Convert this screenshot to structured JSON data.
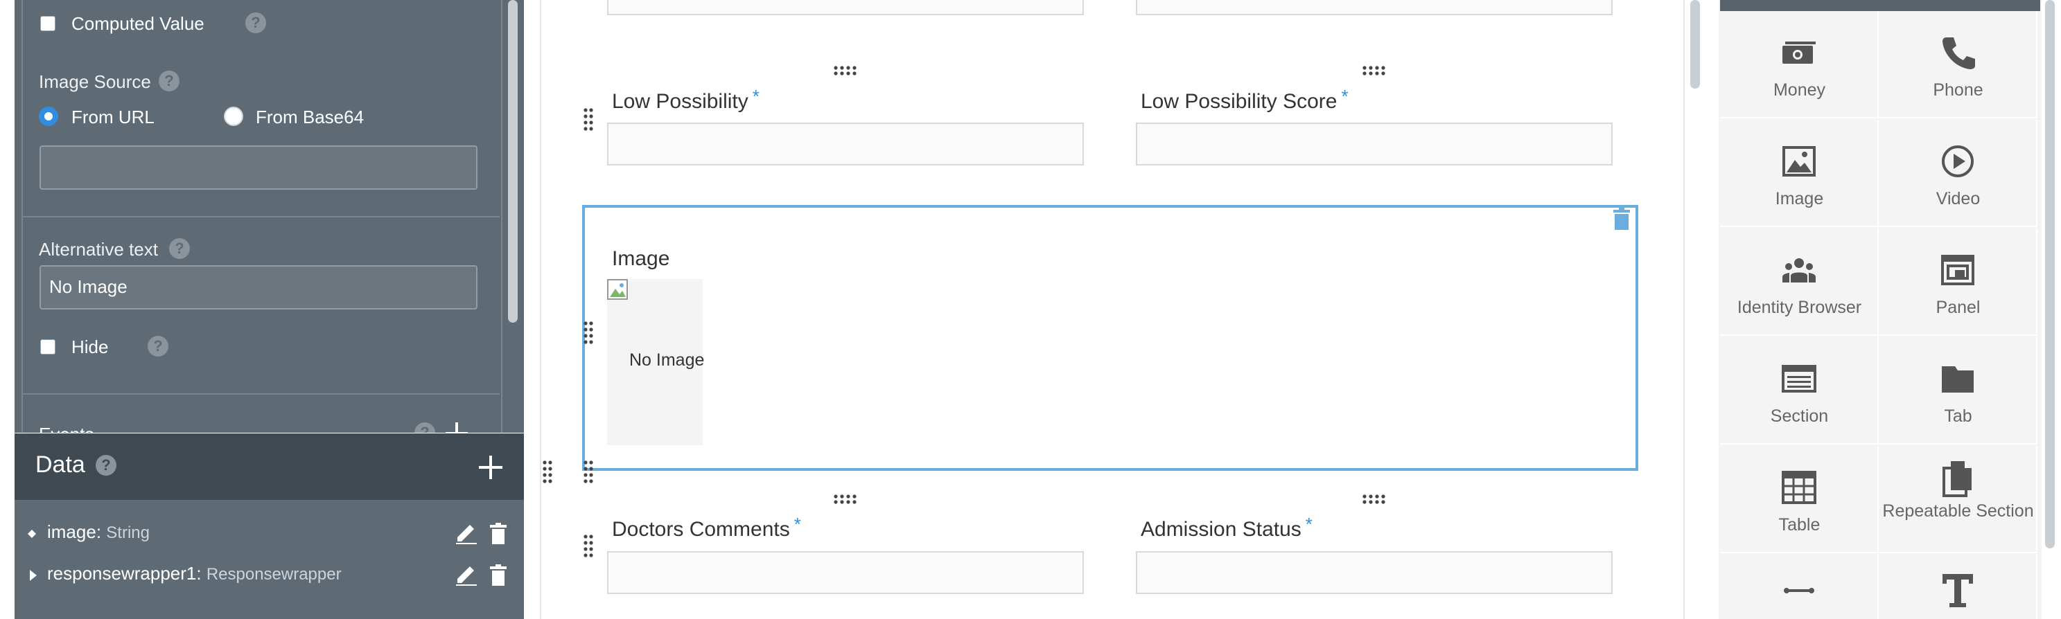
{
  "properties": {
    "computed_value_label": "Computed Value",
    "image_source_label": "Image Source",
    "from_url_label": "From URL",
    "from_base64_label": "From Base64",
    "url_value": "",
    "alt_text_label": "Alternative text",
    "alt_text_value": "No Image",
    "hide_label": "Hide",
    "events_label": "Events",
    "help_glyph": "?"
  },
  "data_panel": {
    "title": "Data",
    "help_glyph": "?",
    "items": [
      {
        "name": "image:",
        "type": "String"
      },
      {
        "name": "responsewrapper1:",
        "type": "Responsewrapper"
      }
    ]
  },
  "form": {
    "row1": [
      {
        "label": "Low Possibility",
        "required": "*"
      },
      {
        "label": "Low Possibility Score",
        "required": "*"
      }
    ],
    "image_block": {
      "label": "Image",
      "placeholder": "No Image"
    },
    "row2": [
      {
        "label": "Doctors Comments",
        "required": "*"
      },
      {
        "label": "Admission Status",
        "required": "*"
      }
    ]
  },
  "palette": {
    "items": [
      {
        "label": "Money",
        "icon": "money-icon"
      },
      {
        "label": "Phone",
        "icon": "phone-icon"
      },
      {
        "label": "Image",
        "icon": "image-icon"
      },
      {
        "label": "Video",
        "icon": "video-icon"
      },
      {
        "label": "Identity Browser",
        "icon": "identity-browser-icon"
      },
      {
        "label": "Panel",
        "icon": "panel-icon"
      },
      {
        "label": "Section",
        "icon": "section-icon"
      },
      {
        "label": "Tab",
        "icon": "tab-icon"
      },
      {
        "label": "Table",
        "icon": "table-icon"
      },
      {
        "label": "Repeatable Section",
        "icon": "repeatable-section-icon"
      },
      {
        "label": "",
        "icon": "separator-icon"
      },
      {
        "label": "",
        "icon": "text-icon"
      }
    ]
  },
  "colors": {
    "panel_bg": "#5e6a74",
    "panel_header": "#404a52",
    "accent": "#2f8ee0",
    "selection": "#6aaee0",
    "palette_bg": "#f4f4f4",
    "icon": "#555555"
  }
}
